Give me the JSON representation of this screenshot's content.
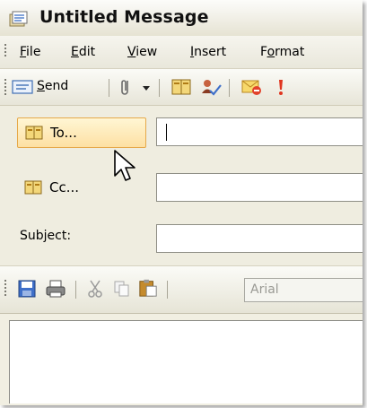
{
  "window": {
    "title": "Untitled Message"
  },
  "menu": {
    "items": [
      {
        "label": "File",
        "underline": "F",
        "rest": "ile"
      },
      {
        "label": "Edit",
        "underline": "E",
        "rest": "dit"
      },
      {
        "label": "View",
        "underline": "V",
        "rest": "iew"
      },
      {
        "label": "Insert",
        "underline": "I",
        "rest": "nsert"
      },
      {
        "label": "Format",
        "pre": "F",
        "underline": "o",
        "rest": "rmat"
      }
    ]
  },
  "toolbar": {
    "send_underline": "S",
    "send_rest": "end"
  },
  "headers": {
    "to_label": "To...",
    "cc_label": "Cc...",
    "subject_label": "Subject:",
    "to_value": "",
    "cc_value": "",
    "subject_value": ""
  },
  "format_toolbar": {
    "font_name": "Arial"
  },
  "colors": {
    "accent_hover": "#fde0a3",
    "window_bg": "#f1efe2"
  }
}
